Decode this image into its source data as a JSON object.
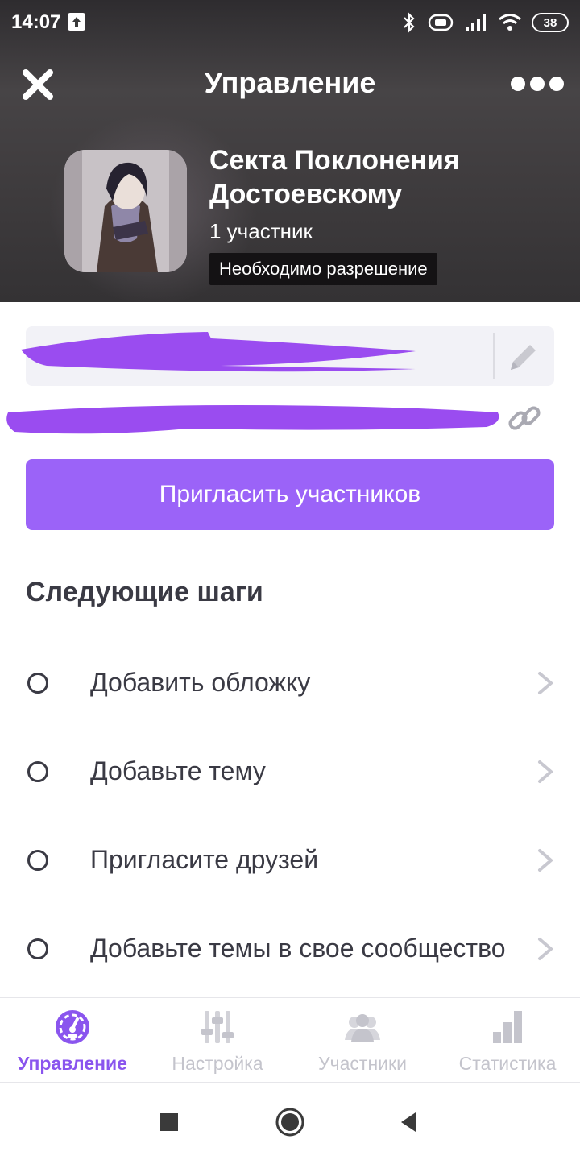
{
  "status_bar": {
    "time": "14:07",
    "battery": "38",
    "icons": [
      "upload-icon",
      "bluetooth-icon",
      "vibrate-icon",
      "signal-icon",
      "wifi-icon",
      "battery-icon"
    ]
  },
  "header": {
    "title": "Управление",
    "close_icon": "close-icon",
    "more_icon": "more-icon"
  },
  "community": {
    "name": "Секта Поклонения Достоевскому",
    "members": "1 участник",
    "permission": "Необходимо разрешение"
  },
  "actions": {
    "invite_label": "Пригласить участников",
    "edit_icon": "pencil-icon",
    "link_icon": "link-icon"
  },
  "next_steps": {
    "title": "Следующие шаги",
    "items": [
      {
        "label": "Добавить обложку"
      },
      {
        "label": "Добавьте тему"
      },
      {
        "label": "Пригласите друзей"
      },
      {
        "label": "Добавьте темы в свое сообщество"
      }
    ]
  },
  "tabs": [
    {
      "label": "Управление",
      "icon": "dashboard-icon",
      "active": true
    },
    {
      "label": "Настройка",
      "icon": "sliders-icon",
      "active": false
    },
    {
      "label": "Участники",
      "icon": "members-icon",
      "active": false
    },
    {
      "label": "Статистика",
      "icon": "stats-icon",
      "active": false
    }
  ],
  "colors": {
    "accent": "#9b63f8",
    "active_tab": "#8a55ee",
    "inactive_tab": "#c4c4cc",
    "scribble": "#9a4cf0"
  }
}
